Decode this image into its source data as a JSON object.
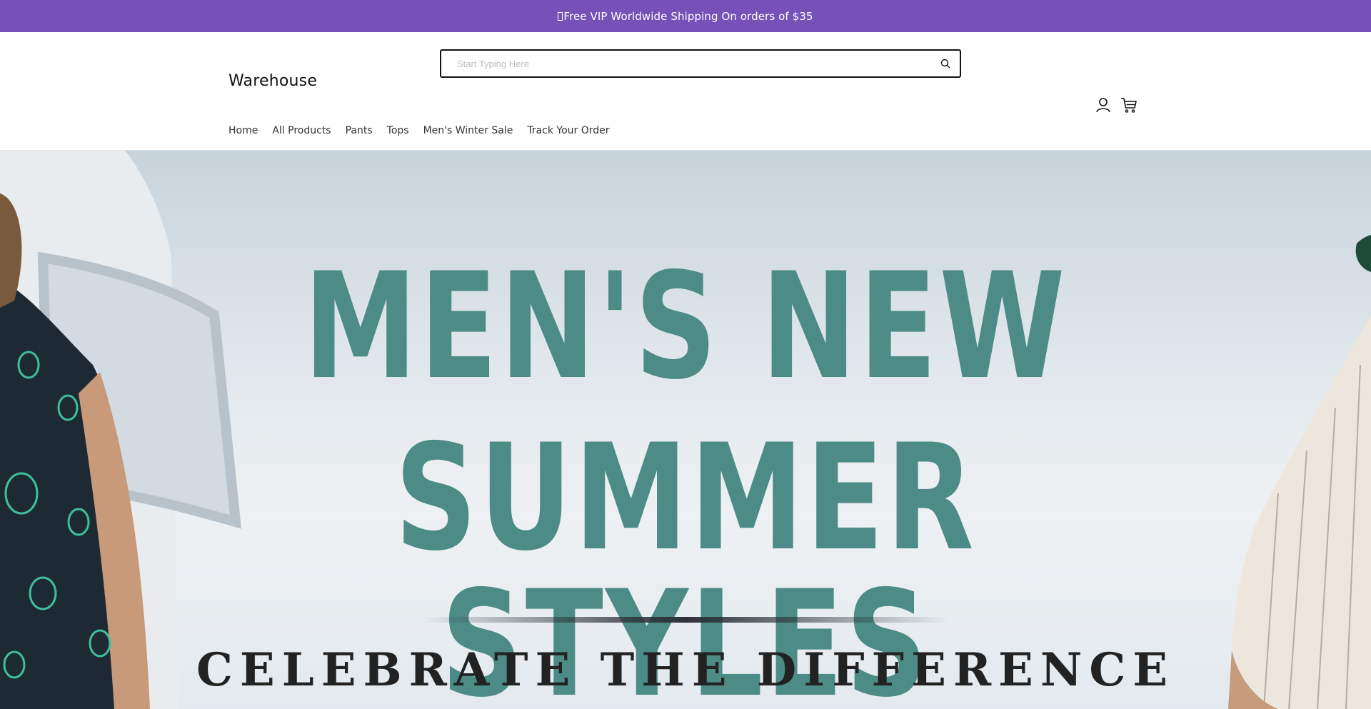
{
  "announcement": {
    "text": "Free VIP Worldwide Shipping On orders of $35",
    "background": "#7750b8"
  },
  "header": {
    "logo": "Warehouse",
    "search": {
      "placeholder": "Start Typing Here",
      "value": "",
      "icon": "search-icon"
    },
    "icons": [
      "user-icon",
      "cart-icon"
    ]
  },
  "nav": {
    "items": [
      {
        "label": "Home"
      },
      {
        "label": "All Products"
      },
      {
        "label": "Pants"
      },
      {
        "label": "Tops"
      },
      {
        "label": "Men's Winter Sale"
      },
      {
        "label": "Track Your Order"
      }
    ]
  },
  "hero": {
    "title_line1": "MEN'S NEW",
    "title_line2": "SUMMER STYLES",
    "subtitle": "CELEBRATE THE DIFFERENCE",
    "title_color": "#4d8c86"
  }
}
